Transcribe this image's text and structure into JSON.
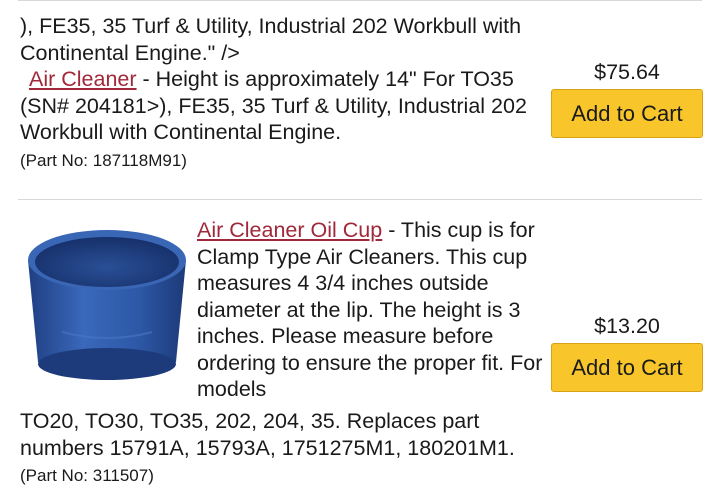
{
  "item1": {
    "continuation": "), FE35, 35 Turf & Utility, Industrial 202 Workbull with Continental Engine.\" />",
    "link": "Air Cleaner",
    "description": " - Height is approximately 14\" For TO35 (SN# 204181>), FE35, 35 Turf & Utility, Industrial 202 Workbull with Continental Engine.",
    "part_no": "(Part No: 187118M91)",
    "price": "$75.64",
    "button": "Add to Cart"
  },
  "item2": {
    "link": "Air Cleaner Oil Cup",
    "description_top": " - This cup is for Clamp Type Air Cleaners. This cup measures 4 3/4 inches outside diameter at the lip. The height is 3 inches. Please measure before ordering to ensure the proper fit. For models",
    "description_bottom": "TO20, TO30, TO35, 202, 204, 35. Replaces part numbers 15791A, 15793A, 1751275M1, 180201M1.",
    "part_no": "(Part No: 311507)",
    "price": "$13.20",
    "button": "Add to Cart",
    "image_icon": "blue-oil-cup",
    "image_color": "#2f5aa8"
  },
  "colors": {
    "link": "#a0283a",
    "button_bg": "#f8c62a",
    "divider": "#d8d8d8"
  }
}
